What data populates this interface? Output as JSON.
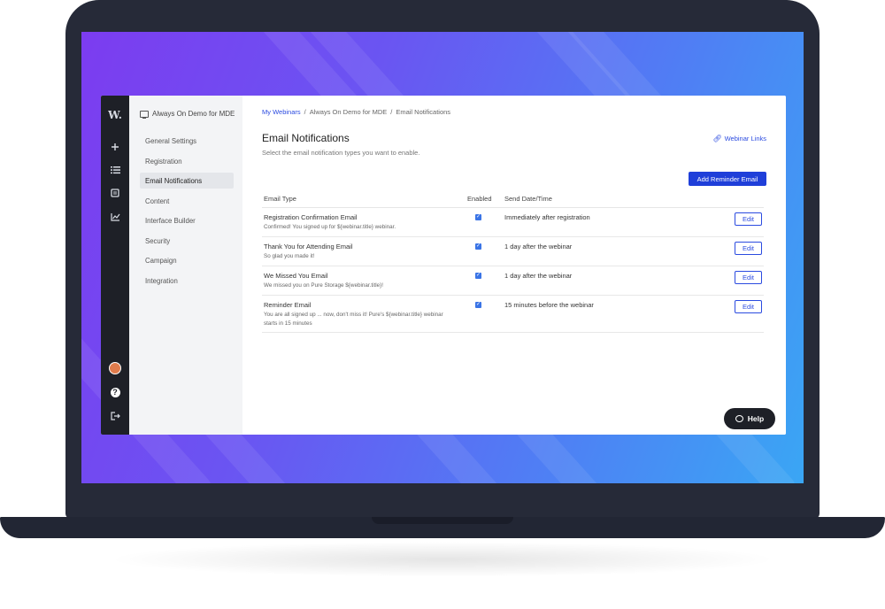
{
  "rail": {
    "logo": "W.",
    "icons": [
      "plus-icon",
      "list-icon",
      "book-icon",
      "chart-icon",
      "avatar",
      "help-circle-icon",
      "logout-icon"
    ]
  },
  "sidenav": {
    "project_title": "Always On Demo for MDE",
    "items": [
      {
        "label": "General Settings",
        "active": false
      },
      {
        "label": "Registration",
        "active": false
      },
      {
        "label": "Email Notifications",
        "active": true
      },
      {
        "label": "Content",
        "active": false
      },
      {
        "label": "Interface Builder",
        "active": false
      },
      {
        "label": "Security",
        "active": false
      },
      {
        "label": "Campaign",
        "active": false
      },
      {
        "label": "Integration",
        "active": false
      }
    ]
  },
  "breadcrumb": {
    "items": [
      "My Webinars",
      "Always On Demo for MDE",
      "Email Notifications"
    ],
    "separator": "/"
  },
  "main": {
    "title": "Email Notifications",
    "subtitle": "Select the email notification types you want to enable.",
    "webinar_links": "Webinar Links",
    "add_button": "Add Reminder Email"
  },
  "table": {
    "headers": {
      "type": "Email Type",
      "enabled": "Enabled",
      "date": "Send Date/Time"
    },
    "edit_label": "Edit",
    "rows": [
      {
        "title": "Registration Confirmation Email",
        "desc": "Confirmed! You signed up for ${webinar.title} webinar.",
        "enabled": true,
        "send": "Immediately after registration"
      },
      {
        "title": "Thank You for Attending Email",
        "desc": "So glad you made it!",
        "enabled": true,
        "send": "1 day after the webinar"
      },
      {
        "title": "We Missed You Email",
        "desc": "We missed you on Pure Storage ${webinar.title}!",
        "enabled": true,
        "send": "1 day after the webinar"
      },
      {
        "title": "Reminder Email",
        "desc": "You are all signed up ... now, don't miss it! Pure's ${webinar.title} webinar starts in 15 minutes",
        "enabled": true,
        "send": "15 minutes before the webinar"
      }
    ]
  },
  "help": {
    "label": "Help"
  },
  "colors": {
    "accent": "#1f3fd9",
    "rail": "#1e2027",
    "checkbox": "#3a74e6"
  }
}
